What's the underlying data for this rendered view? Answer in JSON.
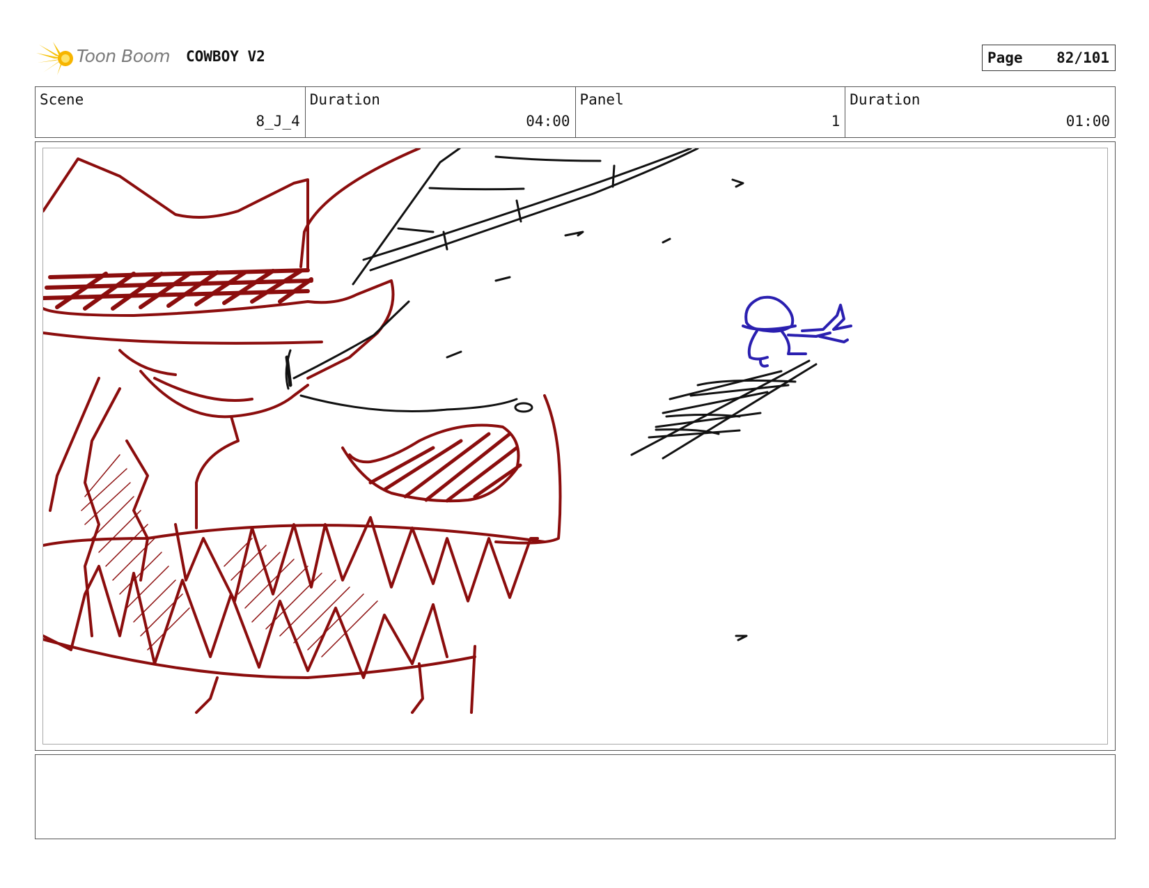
{
  "header": {
    "logo_text": "Toon Boom",
    "project_title": "COWBOY V2",
    "page_label": "Page",
    "page_number": "82/101"
  },
  "info": {
    "scene_label": "Scene",
    "scene_value": "8_J_4",
    "scene_duration_label": "Duration",
    "scene_duration_value": "04:00",
    "panel_label": "Panel",
    "panel_value": "1",
    "panel_duration_label": "Duration",
    "panel_duration_value": "01:00"
  },
  "sketch": {
    "colors": {
      "monster": "#8b0d0d",
      "lines": "#111111",
      "character": "#2a1fb0"
    }
  },
  "notes": {
    "text": ""
  }
}
